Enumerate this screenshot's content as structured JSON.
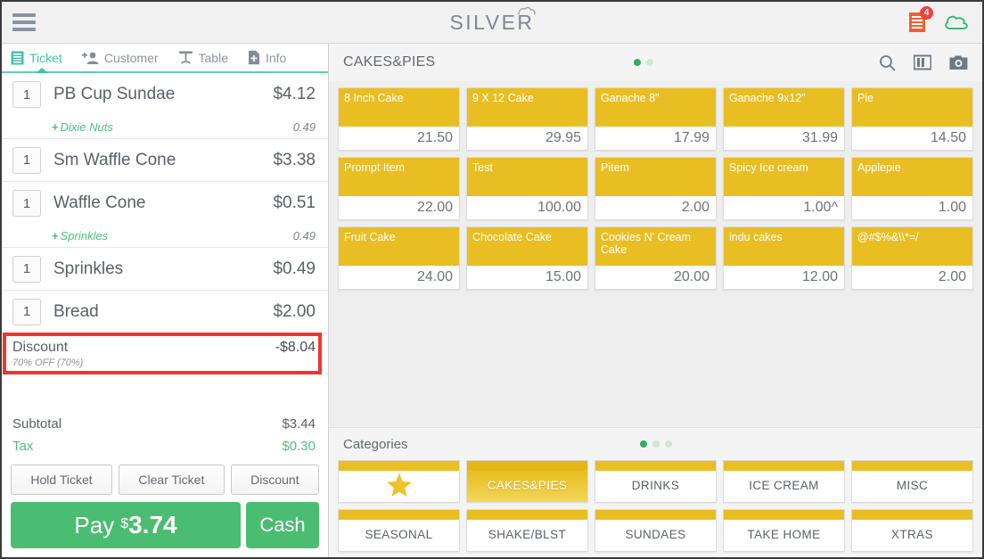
{
  "header": {
    "menu_icon": "hamburger-menu-icon",
    "brand": "SILVER",
    "receipt_icon": "receipt-icon",
    "receipt_badge": "4",
    "cloud_icon": "cloud-icon",
    "accent_red": "#e8453c",
    "accent_green": "#3bb878"
  },
  "ticket": {
    "tabs": [
      {
        "label": "Ticket",
        "icon": "receipt-icon",
        "active": true
      },
      {
        "label": "Customer",
        "icon": "add-person-icon",
        "active": false
      },
      {
        "label": "Table",
        "icon": "table-icon",
        "active": false
      },
      {
        "label": "Info",
        "icon": "add-document-icon",
        "active": false
      }
    ],
    "items": [
      {
        "qty": "1",
        "name": "PB Cup Sundae",
        "price": "$4.12",
        "modifier": {
          "name": "Dixie Nuts",
          "price": "0.49"
        }
      },
      {
        "qty": "1",
        "name": "Sm Waffle Cone",
        "price": "$3.38",
        "modifier": null
      },
      {
        "qty": "1",
        "name": "Waffle Cone",
        "price": "$0.51",
        "modifier": {
          "name": "Sprinkles",
          "price": "0.49"
        }
      },
      {
        "qty": "1",
        "name": "Sprinkles",
        "price": "$0.49",
        "modifier": null
      },
      {
        "qty": "1",
        "name": "Bread",
        "price": "$2.00",
        "modifier": null
      }
    ],
    "discount": {
      "label": "Discount",
      "amount": "-$8.04",
      "sublabel": "70% OFF (70%)",
      "highlight_color": "#f0352f"
    },
    "subtotal_label": "Subtotal",
    "subtotal_value": "$3.44",
    "tax_label": "Tax",
    "tax_value": "$0.30",
    "buttons": {
      "hold": "Hold Ticket",
      "clear": "Clear Ticket",
      "discount": "Discount"
    },
    "pay": {
      "label": "Pay",
      "currency": "$",
      "amount": "3.74",
      "cash_label": "Cash",
      "color": "#4bbd72"
    }
  },
  "products": {
    "title": "CAKES&PIES",
    "page_dots": {
      "count": 2,
      "active_index": 0
    },
    "icons": [
      {
        "name": "search-icon"
      },
      {
        "name": "layout-columns-icon"
      },
      {
        "name": "camera-icon"
      }
    ],
    "tile_color": "#e9be23",
    "tiles": [
      {
        "name": "8 Inch Cake",
        "price": "21.50"
      },
      {
        "name": "9 X 12 Cake",
        "price": "29.95"
      },
      {
        "name": "Ganache 8\"",
        "price": "17.99"
      },
      {
        "name": "Ganache 9x12\"",
        "price": "31.99"
      },
      {
        "name": "Pie",
        "price": "14.50"
      },
      {
        "name": "Prompt Item",
        "price": "22.00"
      },
      {
        "name": "Test",
        "price": "100.00"
      },
      {
        "name": "Pitem",
        "price": "2.00"
      },
      {
        "name": "Spicy Ice cream",
        "price": "1.00^"
      },
      {
        "name": "Applepie",
        "price": "1.00"
      },
      {
        "name": "Fruit Cake",
        "price": "24.00"
      },
      {
        "name": "Chocolate Cake",
        "price": "15.00"
      },
      {
        "name": "Cookies N' Cream Cake",
        "price": "20.00"
      },
      {
        "name": "indu cakes",
        "price": "12.00"
      },
      {
        "name": "@#$%&\\\\*=/",
        "price": "2.00"
      }
    ]
  },
  "categories": {
    "title": "Categories",
    "page_dots": {
      "count": 3,
      "active_index": 0
    },
    "tiles": [
      {
        "label": "",
        "icon": "star-icon",
        "selected": false
      },
      {
        "label": "CAKES&PIES",
        "icon": null,
        "selected": true
      },
      {
        "label": "DRINKS",
        "icon": null,
        "selected": false
      },
      {
        "label": "ICE CREAM",
        "icon": null,
        "selected": false
      },
      {
        "label": "MISC",
        "icon": null,
        "selected": false
      },
      {
        "label": "SEASONAL",
        "icon": null,
        "selected": false
      },
      {
        "label": "SHAKE/BLST",
        "icon": null,
        "selected": false
      },
      {
        "label": "SUNDAES",
        "icon": null,
        "selected": false
      },
      {
        "label": "TAKE HOME",
        "icon": null,
        "selected": false
      },
      {
        "label": "XTRAS",
        "icon": null,
        "selected": false
      }
    ]
  }
}
